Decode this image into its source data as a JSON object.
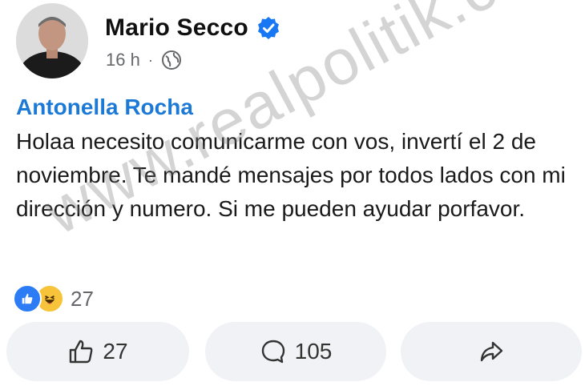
{
  "post": {
    "author_name": "Mario Secco",
    "time": "16 h",
    "separator": "·"
  },
  "comment": {
    "author": "Antonella Rocha",
    "text": "Holaa necesito comunicarme con vos, invertí el 2 de noviembre. Te mandé mensajes por todos lados con mi dirección y numero. Si me pueden ayudar porfavor."
  },
  "reactions": {
    "count": "27",
    "types": [
      "like-icon",
      "haha-icon"
    ]
  },
  "actions": {
    "like_count": "27",
    "comment_count": "105"
  },
  "watermark": "www.realpolitik.com.ar",
  "colors": {
    "author_blue": "#1c7ad6",
    "verified_blue": "#1877f2",
    "button_bg": "#f0f2f5",
    "meta_gray": "#65676b"
  }
}
